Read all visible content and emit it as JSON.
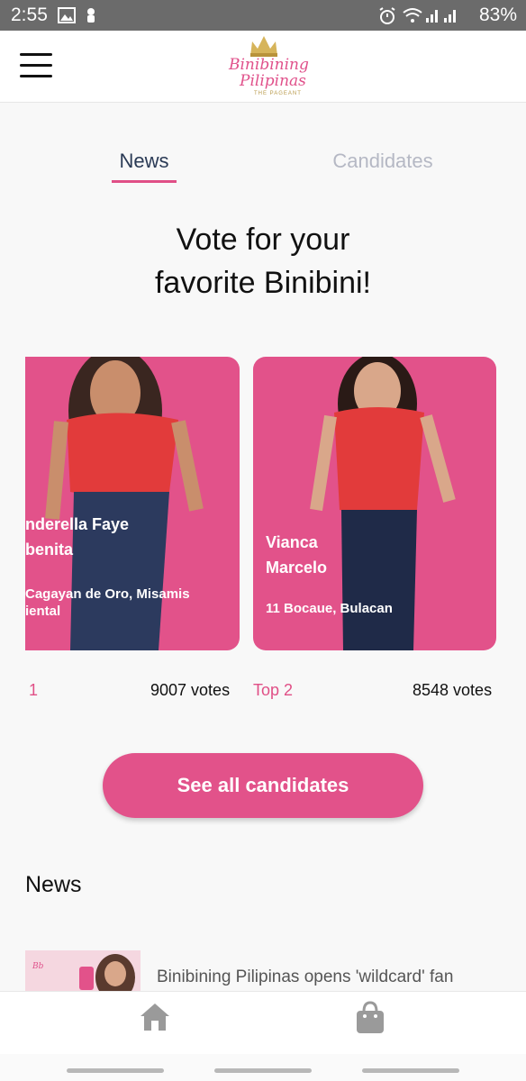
{
  "status_bar": {
    "time": "2:55",
    "battery": "83%"
  },
  "app_bar": {
    "logo_line1": "Binibining",
    "logo_line2": "Pilipinas",
    "logo_line3": "THE PAGEANT"
  },
  "tabs": [
    {
      "label": "News",
      "active": true
    },
    {
      "label": "Candidates",
      "active": false
    }
  ],
  "headline": {
    "line1": "Vote for your",
    "line2": "favorite Binibini!"
  },
  "candidates": [
    {
      "name_line1": "nderella Faye",
      "name_line2": "benita",
      "place_line1": "Cagayan de Oro, Misamis",
      "place_line2": "iental",
      "rank": "1",
      "votes": "9007 votes"
    },
    {
      "name_line1": "Vianca",
      "name_line2": "Marcelo",
      "place_line1": "11 Bocaue, Bulacan",
      "place_line2": "",
      "rank": "Top 2",
      "votes": "8548 votes"
    }
  ],
  "cta": {
    "label": "See all candidates"
  },
  "news": {
    "title": "News",
    "first_item": "Binibining Pilipinas opens 'wildcard' fan"
  },
  "bottom_nav": [
    {
      "icon": "home-icon"
    },
    {
      "icon": "shopping-bag-icon"
    }
  ],
  "colors": {
    "accent": "#e2528a",
    "tab_active": "#2a3a55",
    "tab_inactive": "#b5b8c4"
  }
}
